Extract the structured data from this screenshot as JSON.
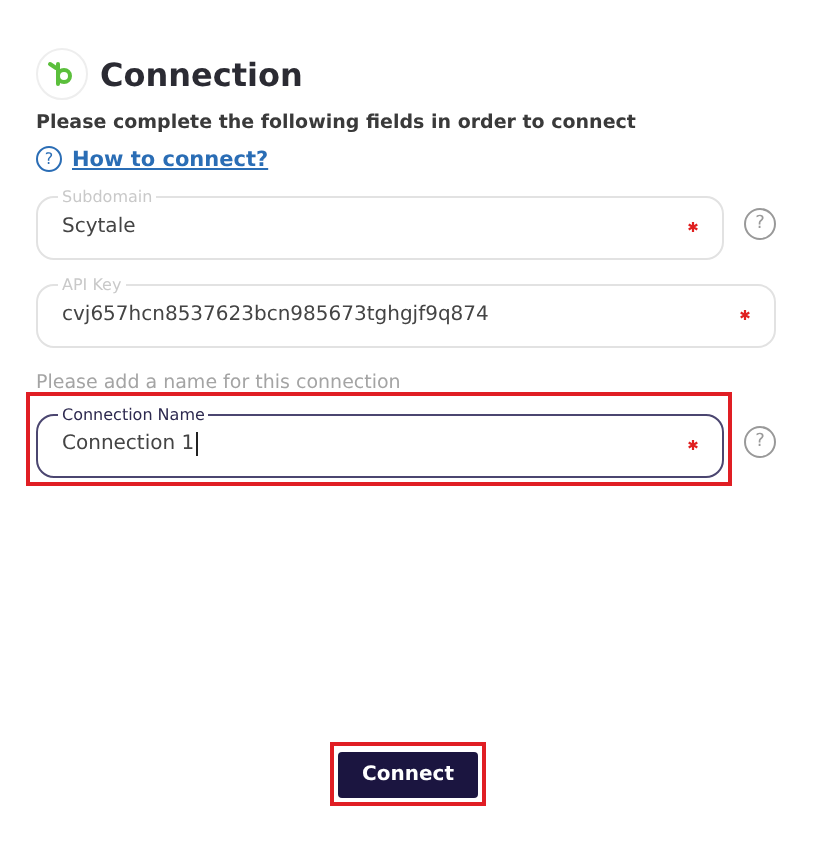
{
  "header": {
    "title": "Connection"
  },
  "instructions": "Please complete the following fields in order to connect",
  "help_link": {
    "icon": "?",
    "label": "How to connect?"
  },
  "fields": [
    {
      "label": "Subdomain",
      "value": "Scytale",
      "required": true,
      "help": "?",
      "focused": false,
      "highlighted": false
    },
    {
      "label": "API Key",
      "value": "cvj657hcn8537623bcn985673tghgjf9q874",
      "required": true,
      "focused": false,
      "highlighted": false
    },
    {
      "note": "Please add a name for this connection",
      "label": "Connection Name",
      "value": "Connection 1",
      "required": true,
      "help": "?",
      "focused": true,
      "highlighted": true
    }
  ],
  "button": {
    "label": "Connect",
    "highlighted": true
  }
}
